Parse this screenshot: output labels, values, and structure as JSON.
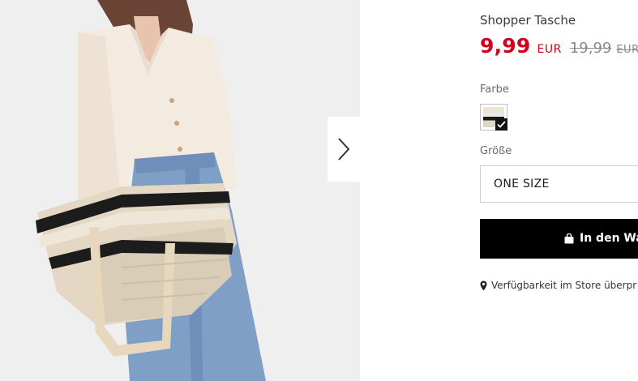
{
  "product": {
    "title": "Shopper Tasche",
    "price": "9,99",
    "currency": "EUR",
    "old_price": "19,99",
    "old_currency": "EUR"
  },
  "color": {
    "label": "Farbe",
    "selected": true
  },
  "size": {
    "label": "Größe",
    "value": "ONE SIZE"
  },
  "cart": {
    "label": "In den Wa",
    "icon": "shopping-bag-icon"
  },
  "store": {
    "label": "Verfügbarkeit im Store überpr",
    "icon": "map-pin-icon"
  },
  "gallery": {
    "next_icon": "chevron-right-icon"
  },
  "colors": {
    "price_red": "#d0021b",
    "button_black": "#000000"
  }
}
